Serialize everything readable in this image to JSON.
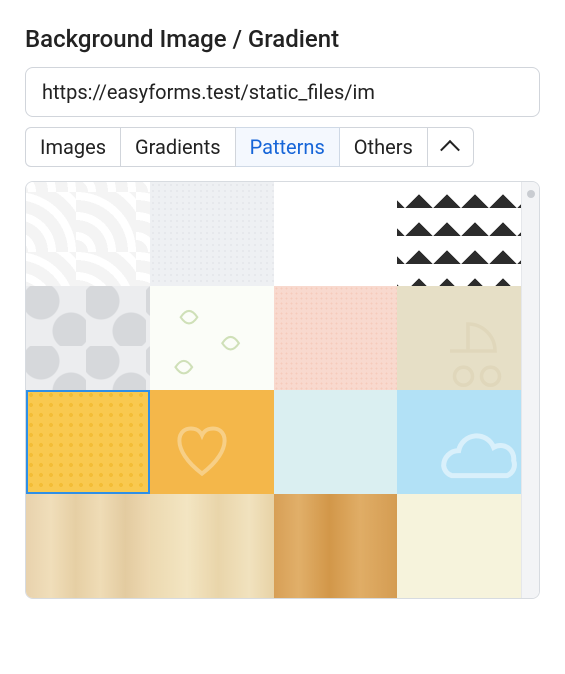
{
  "section": {
    "title": "Background Image / Gradient"
  },
  "input": {
    "url_value": "https://easyforms.test/static_files/im"
  },
  "tabs": {
    "items": [
      {
        "label": "Images",
        "active": false
      },
      {
        "label": "Gradients",
        "active": false
      },
      {
        "label": "Patterns",
        "active": true
      },
      {
        "label": "Others",
        "active": false
      }
    ],
    "collapse_icon": "chevron-up"
  },
  "gallery": {
    "selected_index": 8,
    "swatches": [
      {
        "name": "pattern-waves-light",
        "css": "p-waves"
      },
      {
        "name": "pattern-dots-light",
        "css": "p-dots-light"
      },
      {
        "name": "pattern-plain-white",
        "css": "p-white"
      },
      {
        "name": "pattern-diagonal-dark",
        "css": "p-diag"
      },
      {
        "name": "pattern-quatrefoil",
        "css": "p-quatrefoil"
      },
      {
        "name": "pattern-leaves",
        "css": "p-leaves"
      },
      {
        "name": "pattern-peach-dots",
        "css": "p-peach"
      },
      {
        "name": "pattern-stroller-beige",
        "css": "p-stroller"
      },
      {
        "name": "pattern-yellow-dots",
        "css": "p-yellow-dots"
      },
      {
        "name": "pattern-heart-orange",
        "css": "p-heart"
      },
      {
        "name": "pattern-pale-blue",
        "css": "p-paleblue"
      },
      {
        "name": "pattern-cloud-blue",
        "css": "p-cloud"
      },
      {
        "name": "pattern-wood-light-1",
        "css": "p-wood1"
      },
      {
        "name": "pattern-wood-light-2",
        "css": "p-wood2"
      },
      {
        "name": "pattern-wood-medium",
        "css": "p-wood3"
      },
      {
        "name": "pattern-cream-plain",
        "css": "p-cream"
      }
    ]
  }
}
